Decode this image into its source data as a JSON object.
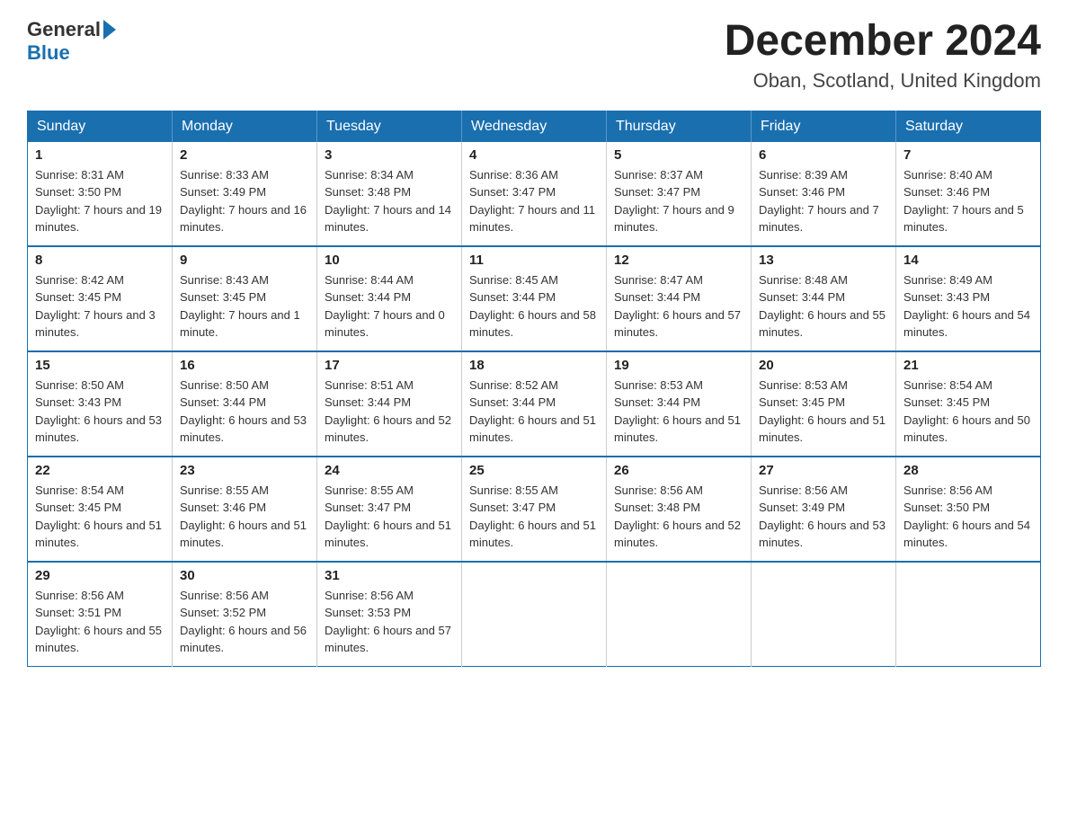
{
  "header": {
    "logo_general": "General",
    "logo_blue": "Blue",
    "title": "December 2024",
    "subtitle": "Oban, Scotland, United Kingdom"
  },
  "calendar": {
    "days": [
      "Sunday",
      "Monday",
      "Tuesday",
      "Wednesday",
      "Thursday",
      "Friday",
      "Saturday"
    ],
    "weeks": [
      [
        {
          "num": "1",
          "sunrise": "8:31 AM",
          "sunset": "3:50 PM",
          "daylight": "7 hours and 19 minutes."
        },
        {
          "num": "2",
          "sunrise": "8:33 AM",
          "sunset": "3:49 PM",
          "daylight": "7 hours and 16 minutes."
        },
        {
          "num": "3",
          "sunrise": "8:34 AM",
          "sunset": "3:48 PM",
          "daylight": "7 hours and 14 minutes."
        },
        {
          "num": "4",
          "sunrise": "8:36 AM",
          "sunset": "3:47 PM",
          "daylight": "7 hours and 11 minutes."
        },
        {
          "num": "5",
          "sunrise": "8:37 AM",
          "sunset": "3:47 PM",
          "daylight": "7 hours and 9 minutes."
        },
        {
          "num": "6",
          "sunrise": "8:39 AM",
          "sunset": "3:46 PM",
          "daylight": "7 hours and 7 minutes."
        },
        {
          "num": "7",
          "sunrise": "8:40 AM",
          "sunset": "3:46 PM",
          "daylight": "7 hours and 5 minutes."
        }
      ],
      [
        {
          "num": "8",
          "sunrise": "8:42 AM",
          "sunset": "3:45 PM",
          "daylight": "7 hours and 3 minutes."
        },
        {
          "num": "9",
          "sunrise": "8:43 AM",
          "sunset": "3:45 PM",
          "daylight": "7 hours and 1 minute."
        },
        {
          "num": "10",
          "sunrise": "8:44 AM",
          "sunset": "3:44 PM",
          "daylight": "7 hours and 0 minutes."
        },
        {
          "num": "11",
          "sunrise": "8:45 AM",
          "sunset": "3:44 PM",
          "daylight": "6 hours and 58 minutes."
        },
        {
          "num": "12",
          "sunrise": "8:47 AM",
          "sunset": "3:44 PM",
          "daylight": "6 hours and 57 minutes."
        },
        {
          "num": "13",
          "sunrise": "8:48 AM",
          "sunset": "3:44 PM",
          "daylight": "6 hours and 55 minutes."
        },
        {
          "num": "14",
          "sunrise": "8:49 AM",
          "sunset": "3:43 PM",
          "daylight": "6 hours and 54 minutes."
        }
      ],
      [
        {
          "num": "15",
          "sunrise": "8:50 AM",
          "sunset": "3:43 PM",
          "daylight": "6 hours and 53 minutes."
        },
        {
          "num": "16",
          "sunrise": "8:50 AM",
          "sunset": "3:44 PM",
          "daylight": "6 hours and 53 minutes."
        },
        {
          "num": "17",
          "sunrise": "8:51 AM",
          "sunset": "3:44 PM",
          "daylight": "6 hours and 52 minutes."
        },
        {
          "num": "18",
          "sunrise": "8:52 AM",
          "sunset": "3:44 PM",
          "daylight": "6 hours and 51 minutes."
        },
        {
          "num": "19",
          "sunrise": "8:53 AM",
          "sunset": "3:44 PM",
          "daylight": "6 hours and 51 minutes."
        },
        {
          "num": "20",
          "sunrise": "8:53 AM",
          "sunset": "3:45 PM",
          "daylight": "6 hours and 51 minutes."
        },
        {
          "num": "21",
          "sunrise": "8:54 AM",
          "sunset": "3:45 PM",
          "daylight": "6 hours and 50 minutes."
        }
      ],
      [
        {
          "num": "22",
          "sunrise": "8:54 AM",
          "sunset": "3:45 PM",
          "daylight": "6 hours and 51 minutes."
        },
        {
          "num": "23",
          "sunrise": "8:55 AM",
          "sunset": "3:46 PM",
          "daylight": "6 hours and 51 minutes."
        },
        {
          "num": "24",
          "sunrise": "8:55 AM",
          "sunset": "3:47 PM",
          "daylight": "6 hours and 51 minutes."
        },
        {
          "num": "25",
          "sunrise": "8:55 AM",
          "sunset": "3:47 PM",
          "daylight": "6 hours and 51 minutes."
        },
        {
          "num": "26",
          "sunrise": "8:56 AM",
          "sunset": "3:48 PM",
          "daylight": "6 hours and 52 minutes."
        },
        {
          "num": "27",
          "sunrise": "8:56 AM",
          "sunset": "3:49 PM",
          "daylight": "6 hours and 53 minutes."
        },
        {
          "num": "28",
          "sunrise": "8:56 AM",
          "sunset": "3:50 PM",
          "daylight": "6 hours and 54 minutes."
        }
      ],
      [
        {
          "num": "29",
          "sunrise": "8:56 AM",
          "sunset": "3:51 PM",
          "daylight": "6 hours and 55 minutes."
        },
        {
          "num": "30",
          "sunrise": "8:56 AM",
          "sunset": "3:52 PM",
          "daylight": "6 hours and 56 minutes."
        },
        {
          "num": "31",
          "sunrise": "8:56 AM",
          "sunset": "3:53 PM",
          "daylight": "6 hours and 57 minutes."
        },
        null,
        null,
        null,
        null
      ]
    ]
  }
}
